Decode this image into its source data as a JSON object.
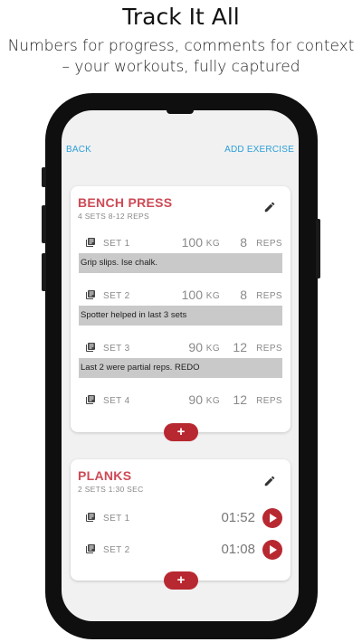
{
  "promo": {
    "title": "Track It All",
    "subtitle_line1": "Numbers for progress, comments for context",
    "subtitle_line2": "– your workouts, fully captured"
  },
  "nav": {
    "back": "BACK",
    "add_exercise": "ADD EXERCISE"
  },
  "exercises": [
    {
      "name": "BENCH PRESS",
      "summary": "4 SETS  8-12 REPS",
      "sets": [
        {
          "label": "SET 1",
          "weight": "100",
          "weight_unit": "KG",
          "reps": "8",
          "reps_unit": "REPS",
          "comment": "Grip slips. Ise chalk."
        },
        {
          "label": "SET 2",
          "weight": "100",
          "weight_unit": "KG",
          "reps": "8",
          "reps_unit": "REPS",
          "comment": "Spotter helped in last 3 sets"
        },
        {
          "label": "SET 3",
          "weight": "90",
          "weight_unit": "KG",
          "reps": "12",
          "reps_unit": "REPS",
          "comment": "Last 2 were partial reps. REDO"
        },
        {
          "label": "SET 4",
          "weight": "90",
          "weight_unit": "KG",
          "reps": "12",
          "reps_unit": "REPS"
        }
      ],
      "add_label": "+"
    },
    {
      "name": "PLANKS",
      "summary": "2 SETS  1:30 SEC",
      "sets": [
        {
          "label": "SET 1",
          "time": "01:52"
        },
        {
          "label": "SET 2",
          "time": "01:08"
        }
      ],
      "add_label": "+"
    }
  ],
  "icons": {
    "edit": "pencil-icon",
    "notes": "notes-icon",
    "play": "play-icon"
  },
  "colors": {
    "accent": "#cd4a55",
    "button": "#b82830",
    "link": "#2d9fd8",
    "comment_bg": "#c9c9c9"
  }
}
